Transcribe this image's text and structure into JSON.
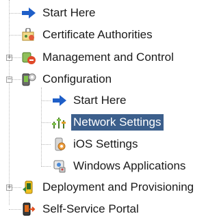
{
  "tree": {
    "items": [
      {
        "label": "Start Here",
        "icon": "blue-arrow-icon",
        "expander": ""
      },
      {
        "label": "Certificate Authorities",
        "icon": "certificate-icon",
        "expander": ""
      },
      {
        "label": "Management and Control",
        "icon": "management-icon",
        "expander": "+"
      },
      {
        "label": "Configuration",
        "icon": "configuration-icon",
        "expander": "−"
      },
      {
        "label": "Start Here",
        "icon": "blue-arrow-icon",
        "expander": ""
      },
      {
        "label": "Network Settings",
        "icon": "network-settings-icon",
        "expander": "",
        "selected": true
      },
      {
        "label": "iOS Settings",
        "icon": "ios-settings-icon",
        "expander": ""
      },
      {
        "label": "Windows Applications",
        "icon": "windows-applications-icon",
        "expander": ""
      },
      {
        "label": "Deployment and Provisioning",
        "icon": "deployment-icon",
        "expander": "+"
      },
      {
        "label": "Self-Service Portal",
        "icon": "self-service-portal-icon",
        "expander": ""
      }
    ]
  },
  "colors": {
    "selection_bg": "#3c5f8c",
    "arrow_blue": "#1f5fc8"
  }
}
